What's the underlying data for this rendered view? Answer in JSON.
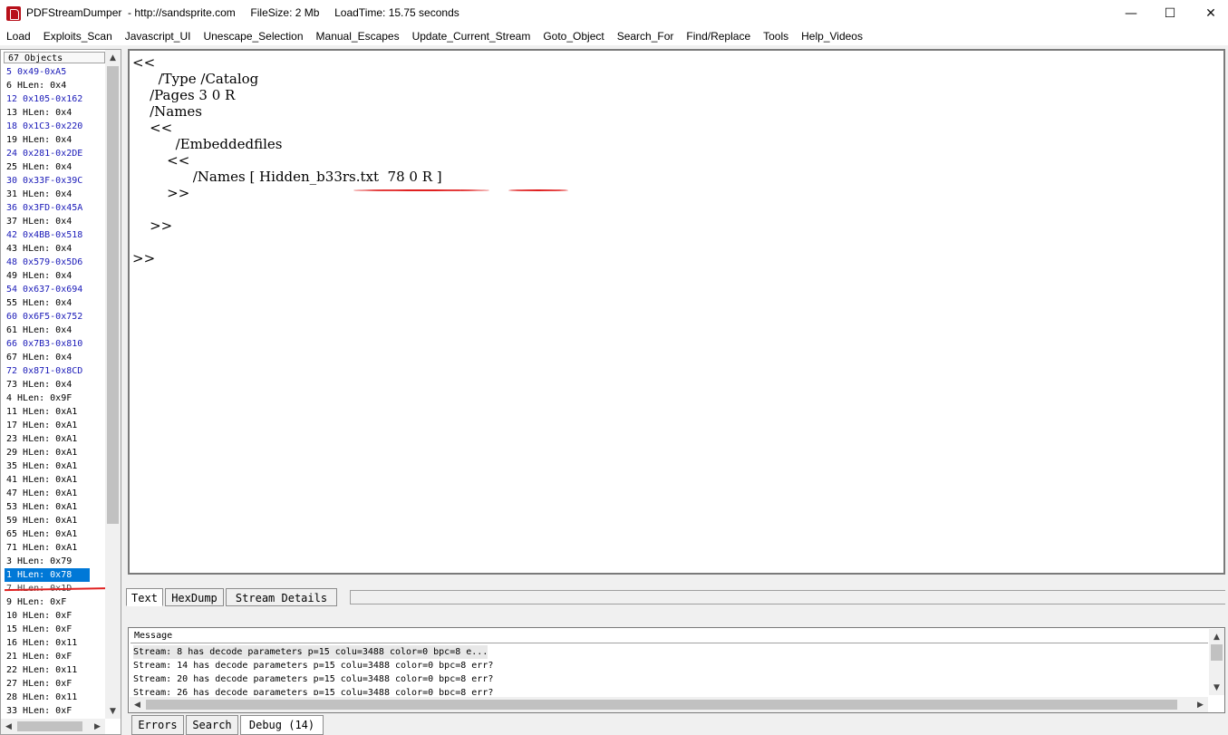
{
  "titlebar": {
    "text": "PDFStreamDumper  - http://sandsprite.com     FileSize: 2 Mb     LoadTime: 15.75 seconds",
    "minimize": "—",
    "maximize": "☐",
    "close": "✕"
  },
  "menu": [
    "Load",
    "Exploits_Scan",
    "Javascript_UI",
    "Unescape_Selection",
    "Manual_Escapes",
    "Update_Current_Stream",
    "Goto_Object",
    "Search_For",
    "Find/Replace",
    "Tools",
    "Help_Videos"
  ],
  "objects": {
    "header": "67 Objects",
    "items": [
      "5 0x49-0xA5",
      "6 HLen: 0x4",
      "12 0x105-0x162",
      "13 HLen: 0x4",
      "18 0x1C3-0x220",
      "19 HLen: 0x4",
      "24 0x281-0x2DE",
      "25 HLen: 0x4",
      "30 0x33F-0x39C",
      "31 HLen: 0x4",
      "36 0x3FD-0x45A",
      "37 HLen: 0x4",
      "42 0x4BB-0x518",
      "43 HLen: 0x4",
      "48 0x579-0x5D6",
      "49 HLen: 0x4",
      "54 0x637-0x694",
      "55 HLen: 0x4",
      "60 0x6F5-0x752",
      "61 HLen: 0x4",
      "66 0x7B3-0x810",
      "67 HLen: 0x4",
      "72 0x871-0x8CD",
      "73 HLen: 0x4",
      "4 HLen: 0x9F",
      "11 HLen: 0xA1",
      "17 HLen: 0xA1",
      "23 HLen: 0xA1",
      "29 HLen: 0xA1",
      "35 HLen: 0xA1",
      "41 HLen: 0xA1",
      "47 HLen: 0xA1",
      "53 HLen: 0xA1",
      "59 HLen: 0xA1",
      "65 HLen: 0xA1",
      "71 HLen: 0xA1",
      "3 HLen: 0x79",
      "1 HLen: 0x78",
      "7 HLen: 0x1D",
      "9 HLen: 0xF",
      "10 HLen: 0xF",
      "15 HLen: 0xF",
      "16 HLen: 0x11",
      "21 HLen: 0xF",
      "22 HLen: 0x11",
      "27 HLen: 0xF",
      "28 HLen: 0x11",
      "33 HLen: 0xF"
    ],
    "selected_index": 37,
    "struck_index": 38
  },
  "textview": {
    "lines": [
      "<<",
      "      /Type /Catalog",
      "    /Pages 3 0 R",
      "    /Names",
      "    <<",
      "          /Embeddedfiles",
      "        <<",
      "              /Names [ Hidden_b33rs.txt  78 0 R ]",
      "        >>",
      "",
      "    >>",
      "",
      ">>"
    ]
  },
  "tabs": [
    "Text",
    "HexDump",
    "Stream Details"
  ],
  "messages": {
    "header": "Message",
    "lines": [
      "Stream: 8 has decode parameters p=15 colu=3488 color=0 bpc=8 e...",
      "Stream: 14 has decode parameters p=15 colu=3488 color=0 bpc=8 err?",
      "Stream: 20 has decode parameters p=15 colu=3488 color=0 bpc=8 err?",
      "Stream: 26 has decode parameters p=15 colu=3488 color=0 bpc=8 err?"
    ]
  },
  "bottom_tabs": [
    "Errors",
    "Search",
    "Debug (14)"
  ],
  "colors": {
    "accent": "#0078d7",
    "annotation": "#e02020",
    "link": "#1a1ab8"
  }
}
